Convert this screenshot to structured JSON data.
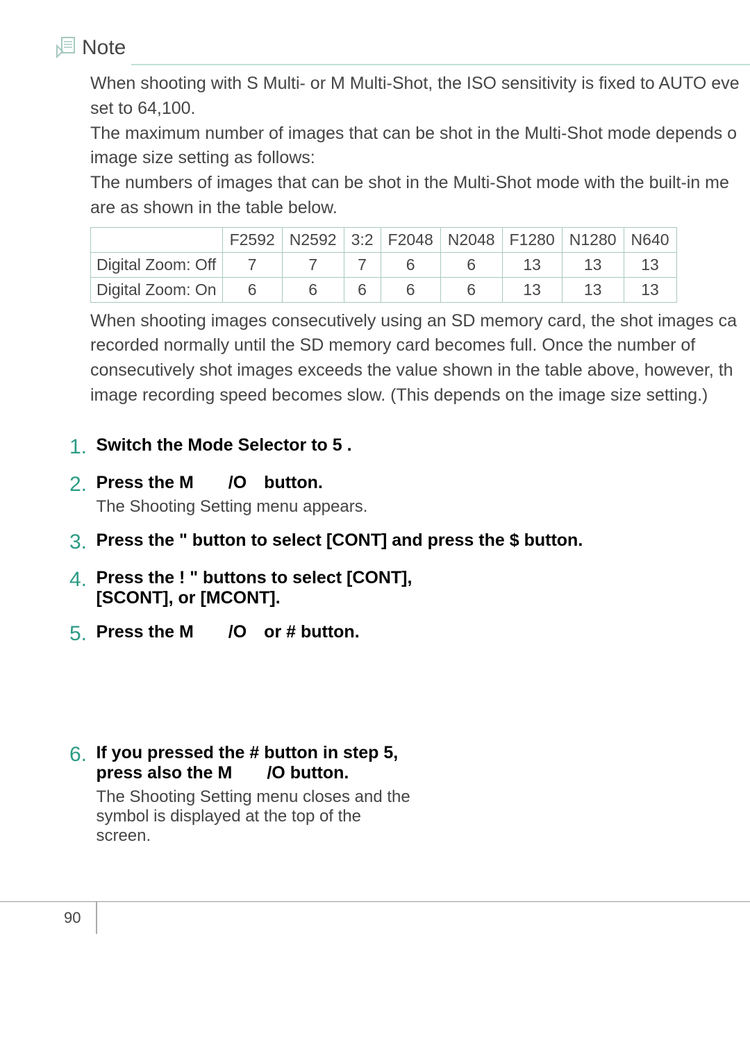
{
  "note": {
    "title": "Note",
    "para1": "When shooting with S Multi- or M Multi-Shot, the ISO sensitivity is fixed to AUTO eve",
    "para1b": "set to 64,100.",
    "para2": "The maximum number of images that can be shot in the Multi-Shot mode depends o",
    "para2b": "image size setting as follows:",
    "para3": "The numbers of images that can be shot in the Multi-Shot mode with the built-in me",
    "para3b": "are as shown in the table below.",
    "para4": "When shooting images consecutively using an SD memory card, the shot images ca",
    "para4b": "recorded normally until the SD memory card becomes full. Once the number of",
    "para4c": "consecutively shot images exceeds the value shown in the table above, however, th",
    "para4d": "image recording speed becomes slow. (This depends on the image size setting.)"
  },
  "table": {
    "headers": [
      "",
      "F2592",
      "N2592",
      "3:2",
      "F2048",
      "N2048",
      "F1280",
      "N1280",
      "N640"
    ],
    "rows": [
      {
        "label": "Digital Zoom: Off",
        "cells": [
          "7",
          "7",
          "7",
          "6",
          "6",
          "13",
          "13",
          "13"
        ]
      },
      {
        "label": "Digital Zoom: On",
        "cells": [
          "6",
          "6",
          "6",
          "6",
          "6",
          "13",
          "13",
          "13"
        ]
      }
    ]
  },
  "steps": [
    {
      "num": "1.",
      "bold": "Switch the Mode Selector to 5 ."
    },
    {
      "num": "2.",
      "bold": "Press the M  /O button.",
      "desc": "The Shooting Setting menu appears."
    },
    {
      "num": "3.",
      "bold": "Press the \"  button to select [CONT] and press the $  button."
    },
    {
      "num": "4.",
      "bold": "Press the !  \"  buttons to select [CONT], [SCONT], or [MCONT]."
    },
    {
      "num": "5.",
      "bold": "Press the M  /O or #  button."
    },
    {
      "num": "6.",
      "bold": "If you pressed the #  button in step 5, press also the M  /O button.",
      "desc": "The Shooting Setting menu closes and the symbol is displayed at the top of the screen."
    }
  ],
  "page_number": "90"
}
